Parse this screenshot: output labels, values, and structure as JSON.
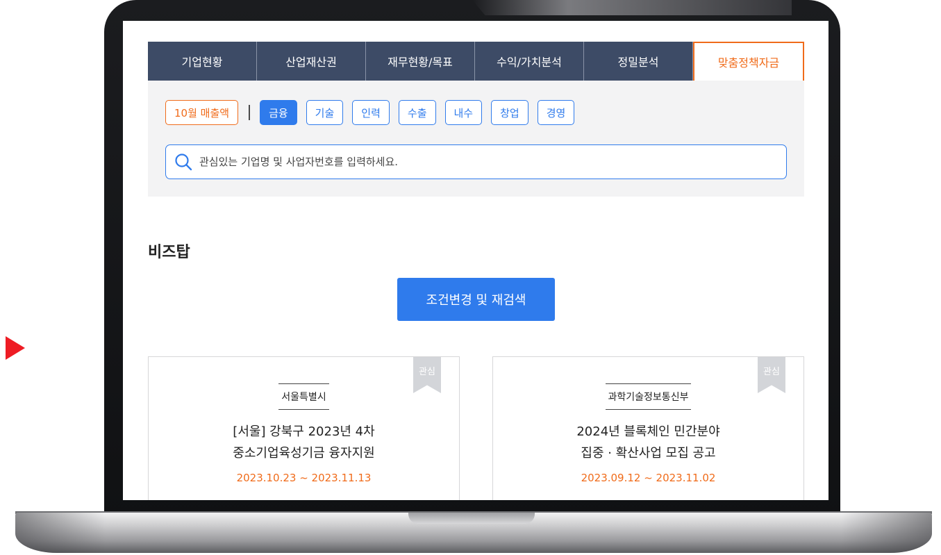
{
  "tabs": [
    {
      "label": "기업현황"
    },
    {
      "label": "산업재산권"
    },
    {
      "label": "재무현황/목표"
    },
    {
      "label": "수익/가치분석"
    },
    {
      "label": "정밀분석"
    },
    {
      "label": "맞춤정책자금",
      "active": true
    }
  ],
  "filters": {
    "sales_chip": "10월 매출액",
    "categories": [
      {
        "label": "금융",
        "selected": true
      },
      {
        "label": "기술"
      },
      {
        "label": "인력"
      },
      {
        "label": "수출"
      },
      {
        "label": "내수"
      },
      {
        "label": "창업"
      },
      {
        "label": "경영"
      }
    ]
  },
  "search": {
    "placeholder": "관심있는 기업명 및 사업자번호를 입력하세요.",
    "icon": "search-icon"
  },
  "section": {
    "title": "비즈탑",
    "research_button": "조건변경 및 재검색"
  },
  "cards": [
    {
      "bookmark": "관심",
      "agency": "서울특별시",
      "title_line1": "[서울] 강북구 2023년 4차",
      "title_line2": "중소기업육성기금 융자지원",
      "period": "2023.10.23 ~ 2023.11.13"
    },
    {
      "bookmark": "관심",
      "agency": "과학기술정보통신부",
      "title_line1": "2024년 블록체인 민간분야",
      "title_line2": "집중 · 확산사업 모집 공고",
      "period": "2023.09.12 ~ 2023.11.02"
    }
  ],
  "colors": {
    "tab_bg": "#3d4b66",
    "accent_orange": "#f06b1a",
    "accent_blue": "#2f7bec",
    "pointer_red": "#ee1c24"
  }
}
